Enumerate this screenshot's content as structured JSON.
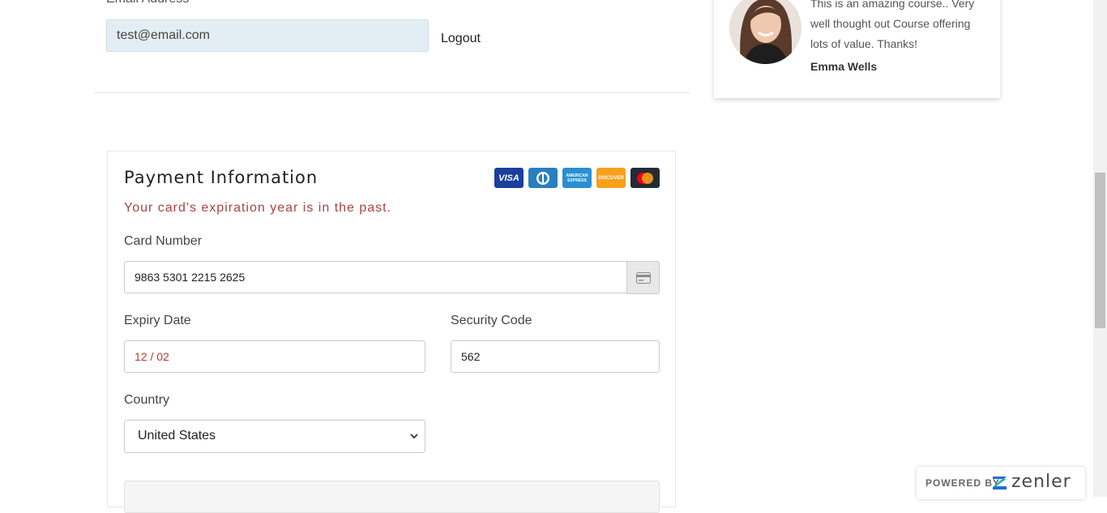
{
  "account": {
    "email_label": "Email Address",
    "email_value": "test@email.com",
    "logout_label": "Logout"
  },
  "testimonial": {
    "quote": "This is an amazing course.. Very well thought out Course offering lots of value. Thanks!",
    "author": "Emma Wells"
  },
  "payment": {
    "title": "Payment Information",
    "error": "Your card's expiration year is in the past.",
    "card_icons": [
      {
        "name": "visa-icon",
        "label": "VISA",
        "color": "#1a3f9c"
      },
      {
        "name": "diners-icon",
        "label": "",
        "color": "#2a7fc0"
      },
      {
        "name": "amex-icon",
        "label": "AMERICAN EXPRESS",
        "color": "#2a8fd2"
      },
      {
        "name": "discover-icon",
        "label": "DISCOVER",
        "color": "#f9a01b"
      },
      {
        "name": "mastercard-icon",
        "label": "",
        "color": "#252b33"
      }
    ],
    "card_number_label": "Card Number",
    "card_number_value": "9863 5301 2215 2625",
    "expiry_label": "Expiry Date",
    "expiry_value": "12 / 02",
    "expiry_color": "#c0392b",
    "security_label": "Security Code",
    "security_value": "562",
    "country_label": "Country",
    "country_value": "United States"
  },
  "footer": {
    "powered_by": "POWERED BY",
    "brand": "zenler"
  }
}
